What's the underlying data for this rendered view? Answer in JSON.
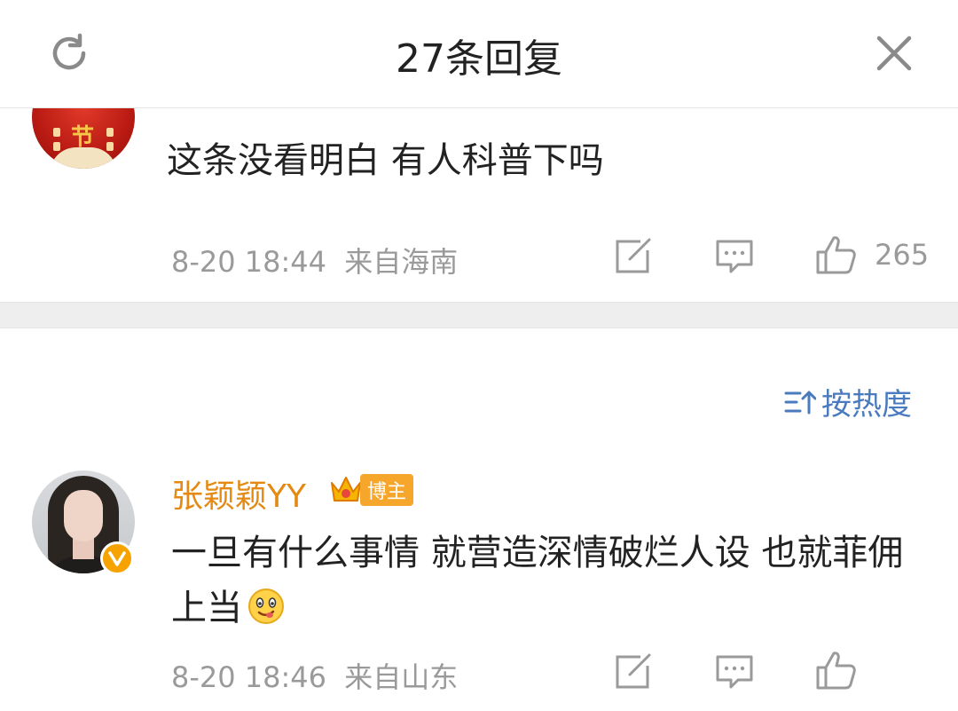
{
  "header": {
    "title": "27条回复"
  },
  "comments": [
    {
      "text": "这条没看明白 有人科普下吗",
      "timestamp": "8-20 18:44",
      "location": "来自海南",
      "likes": "265",
      "avatar_text": "节"
    },
    {
      "username": "张颖颖YY",
      "badge": "博主",
      "text": "一旦有什么事情 就营造深情破烂人设 也就菲佣上当",
      "timestamp": "8-20 18:46",
      "location": "来自山东"
    }
  ],
  "sort": {
    "label": "按热度"
  },
  "icons": {
    "refresh": "refresh-icon",
    "close": "close-icon",
    "repost": "repost-icon",
    "comment": "comment-icon",
    "like": "thumbs-up-icon",
    "sort": "sort-icon",
    "verified": "verified-icon",
    "crown": "crown-icon",
    "emoji": "drooling-face-emoji"
  },
  "colors": {
    "username": "#e48a13",
    "sort_link": "#4a7bbf",
    "meta_gray": "#9a9a9a",
    "verified": "#f6a300"
  }
}
